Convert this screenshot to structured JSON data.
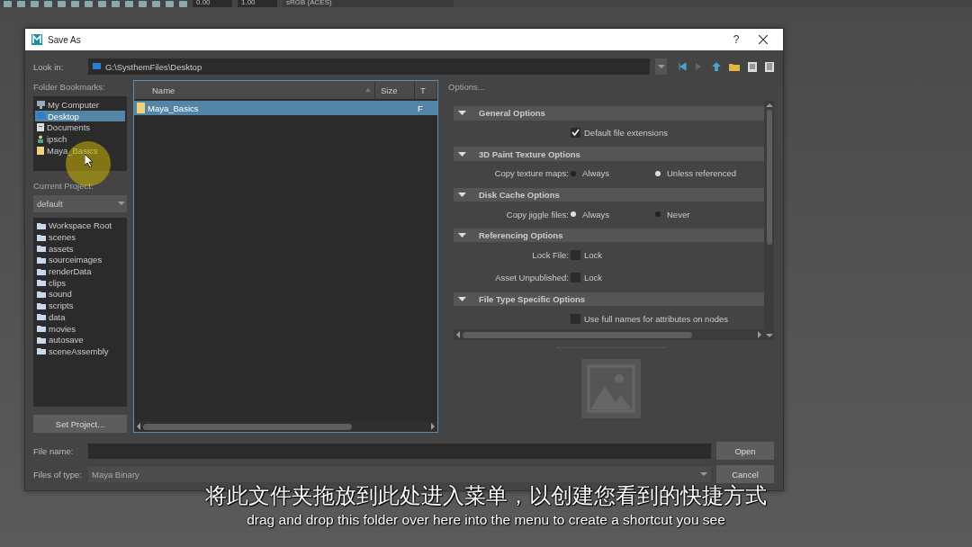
{
  "toolbar": {
    "fields": [
      "0.00",
      "1.00"
    ],
    "color_space": "sRGB (ACES)"
  },
  "window": {
    "title": "Save As",
    "help": "?"
  },
  "look_in": {
    "label": "Look in:",
    "path": "G:\\SysthemFiles\\Desktop"
  },
  "bookmarks": {
    "label": "Folder Bookmarks:",
    "items": [
      {
        "text": "My Computer",
        "kind": "computer",
        "selected": false
      },
      {
        "text": "Desktop",
        "kind": "desktop",
        "selected": true
      },
      {
        "text": "Documents",
        "kind": "document",
        "selected": false
      },
      {
        "text": "ipsch",
        "kind": "user",
        "selected": false
      },
      {
        "text": "Maya_Basics",
        "kind": "folder",
        "selected": false
      }
    ]
  },
  "current_project": {
    "label": "Current Project:",
    "value": "default"
  },
  "project_folders": [
    "Workspace Root",
    "scenes",
    "assets",
    "sourceimages",
    "renderData",
    "clips",
    "sound",
    "scripts",
    "data",
    "movies",
    "autosave",
    "sceneAssembly"
  ],
  "set_project_button": "Set Project...",
  "file_list": {
    "columns": [
      "Name",
      "Size",
      "T"
    ],
    "rows": [
      {
        "name": "Maya_Basics",
        "column_3": "F",
        "selected": true
      }
    ]
  },
  "options": {
    "title": "Options...",
    "sections": [
      {
        "title": "General Options",
        "expanded": true,
        "rows": [
          {
            "kind": "checkbox",
            "text": "Default file extensions",
            "checked": true
          }
        ]
      },
      {
        "title": "3D Paint Texture Options",
        "expanded": true,
        "rows": [
          {
            "kind": "radio",
            "label": "Copy texture maps:",
            "choices": [
              {
                "text": "Always",
                "selected": false
              },
              {
                "text": "Unless referenced",
                "selected": true
              }
            ]
          }
        ]
      },
      {
        "title": "Disk Cache Options",
        "expanded": true,
        "rows": [
          {
            "kind": "radio",
            "label": "Copy jiggle files:",
            "choices": [
              {
                "text": "Always",
                "selected": true
              },
              {
                "text": "Never",
                "selected": false
              }
            ]
          }
        ]
      },
      {
        "title": "Referencing Options",
        "expanded": true,
        "rows": [
          {
            "kind": "checkbox",
            "label": "Lock File:",
            "text": "Lock",
            "checked": false
          },
          {
            "kind": "checkbox",
            "label": "Asset Unpublished:",
            "text": "Lock",
            "checked": false
          }
        ]
      },
      {
        "title": "File Type Specific Options",
        "expanded": true,
        "rows": [
          {
            "kind": "checkbox",
            "text": "Use full names for attributes on nodes",
            "checked": false
          }
        ]
      }
    ]
  },
  "file_name": {
    "label": "File name:",
    "button": "Open"
  },
  "file_type": {
    "label": "Files of type:",
    "value": "Maya Binary",
    "button": "Cancel"
  },
  "subtitles": {
    "chinese": "将此文件夹拖放到此处进入菜单，以创建您看到的快捷方式",
    "english": "drag and drop this folder over here into the menu to create a shortcut you see"
  }
}
